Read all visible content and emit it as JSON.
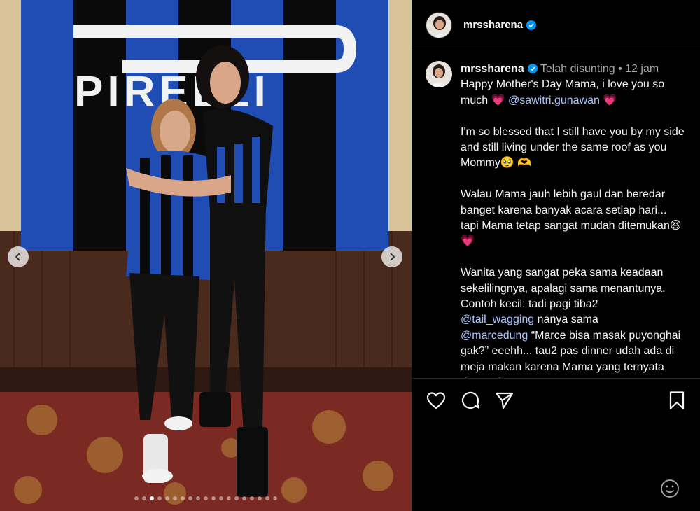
{
  "post": {
    "username": "mrssharena",
    "verified": true,
    "edited_label": "Telah disunting",
    "separator": "•",
    "time_ago": "12 jam",
    "banner_text": "PIRELLI",
    "caption": {
      "p1_text": "Happy Mother's Day Mama, i love you so much",
      "p1_emoji": "💗",
      "p1_mention": "@sawitri.gunawan",
      "p1_emoji_end": "💗",
      "p2_text": "I'm so blessed that I still have you by my side and still living under the same roof as you Mommy",
      "p2_emoji": "🥹 🫶",
      "p3_text": "Walau Mama jauh lebih gaul dan beredar banget karena banyak acara setiap hari... tapi Mama tetap sangat mudah ditemukan",
      "p3_emoji": "😆",
      "p3_emoji_end": "💗",
      "p4_text_a": "Wanita yang sangat peka sama keadaan sekelilingnya, apalagi sama menantunya. Contoh kecil: tadi pagi tiba2",
      "p4_mention_a": "@tail_wagging",
      "p4_text_b": "nanya sama",
      "p4_mention_b": "@marcedung",
      "p4_text_c": "“Marce bisa masak puyonghai gak?” eeehh... tau2 pas dinner udah ada di meja makan karena Mama yang ternyata dengar langsung"
    }
  },
  "carousel": {
    "dot_count": 19,
    "active_index": 2,
    "prev_icon": "chevron-left-icon",
    "next_icon": "chevron-right-icon"
  },
  "actions": {
    "like_icon": "heart-icon",
    "comment_icon": "comment-icon",
    "share_icon": "paper-plane-icon",
    "save_icon": "bookmark-icon",
    "emoji_icon": "smiley-icon"
  },
  "colors": {
    "background": "#000000",
    "text": "#f5f5f5",
    "meta": "#a8a8a8",
    "mention": "#a9c7ff",
    "verified": "#0095f6"
  }
}
